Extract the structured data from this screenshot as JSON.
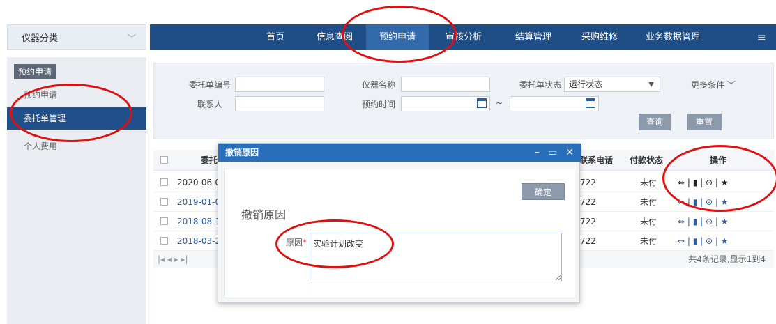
{
  "left_select": {
    "label": "仪器分类",
    "chevron": "chevron-down-icon"
  },
  "nav": {
    "items": [
      {
        "label": "首页",
        "active": false
      },
      {
        "label": "信息查阅",
        "active": false
      },
      {
        "label": "预约申请",
        "active": true
      },
      {
        "label": "审核分析",
        "active": false
      },
      {
        "label": "结算管理",
        "active": false
      },
      {
        "label": "采购维修",
        "active": false
      },
      {
        "label": "业务数据管理",
        "active": false
      }
    ],
    "menu_icon": "hamburger-icon",
    "menu_glyph": "≡"
  },
  "sidebar": {
    "heading": "预约申请",
    "items": [
      {
        "label": "预约申请",
        "active": false
      },
      {
        "label": "委托单管理",
        "active": true
      },
      {
        "label": "个人费用",
        "active": false
      }
    ]
  },
  "search": {
    "order_no_label": "委托单编号",
    "instrument_label": "仪器名称",
    "status_label": "委托单状态",
    "status_value": "运行状态",
    "more_label": "更多条件",
    "contact_label": "联系人",
    "time_label": "预约时间",
    "range_sep": "~",
    "query_button": "查询",
    "reset_button": "重置"
  },
  "table": {
    "columns": [
      "委托",
      "联系电话",
      "付款状态",
      "操作"
    ],
    "rows": [
      {
        "date": "2020-06-0",
        "phone": "722",
        "pay": "未付",
        "link": false
      },
      {
        "date": "2019-01-0",
        "phone": "722",
        "pay": "未付",
        "link": true
      },
      {
        "date": "2018-08-1",
        "phone": "722",
        "pay": "未付",
        "link": true
      },
      {
        "date": "2018-03-2",
        "phone": "722",
        "pay": "未付",
        "link": true
      }
    ],
    "ops": [
      "⇔",
      "|",
      "▮",
      "|",
      "⊙",
      "|",
      "★"
    ],
    "ops_text": "⇔ | ▮ | ⊙ | ★",
    "pager_controls": "|◂  ◂  ▸  ▸|",
    "pager_info": "共4条记录,显示1到4"
  },
  "dialog": {
    "title": "撤销原因",
    "controls": [
      "–",
      "▭",
      "✕"
    ],
    "heading": "撤销原因",
    "confirm_button": "确定",
    "reason_label": "原因",
    "required_mark": "*",
    "reason_value": "实验计划改变"
  },
  "colors": {
    "nav_bg": "#1f4e86",
    "nav_active": "#3169aa",
    "dialog_title": "#2a6fb9",
    "annotation": "#e01010"
  }
}
